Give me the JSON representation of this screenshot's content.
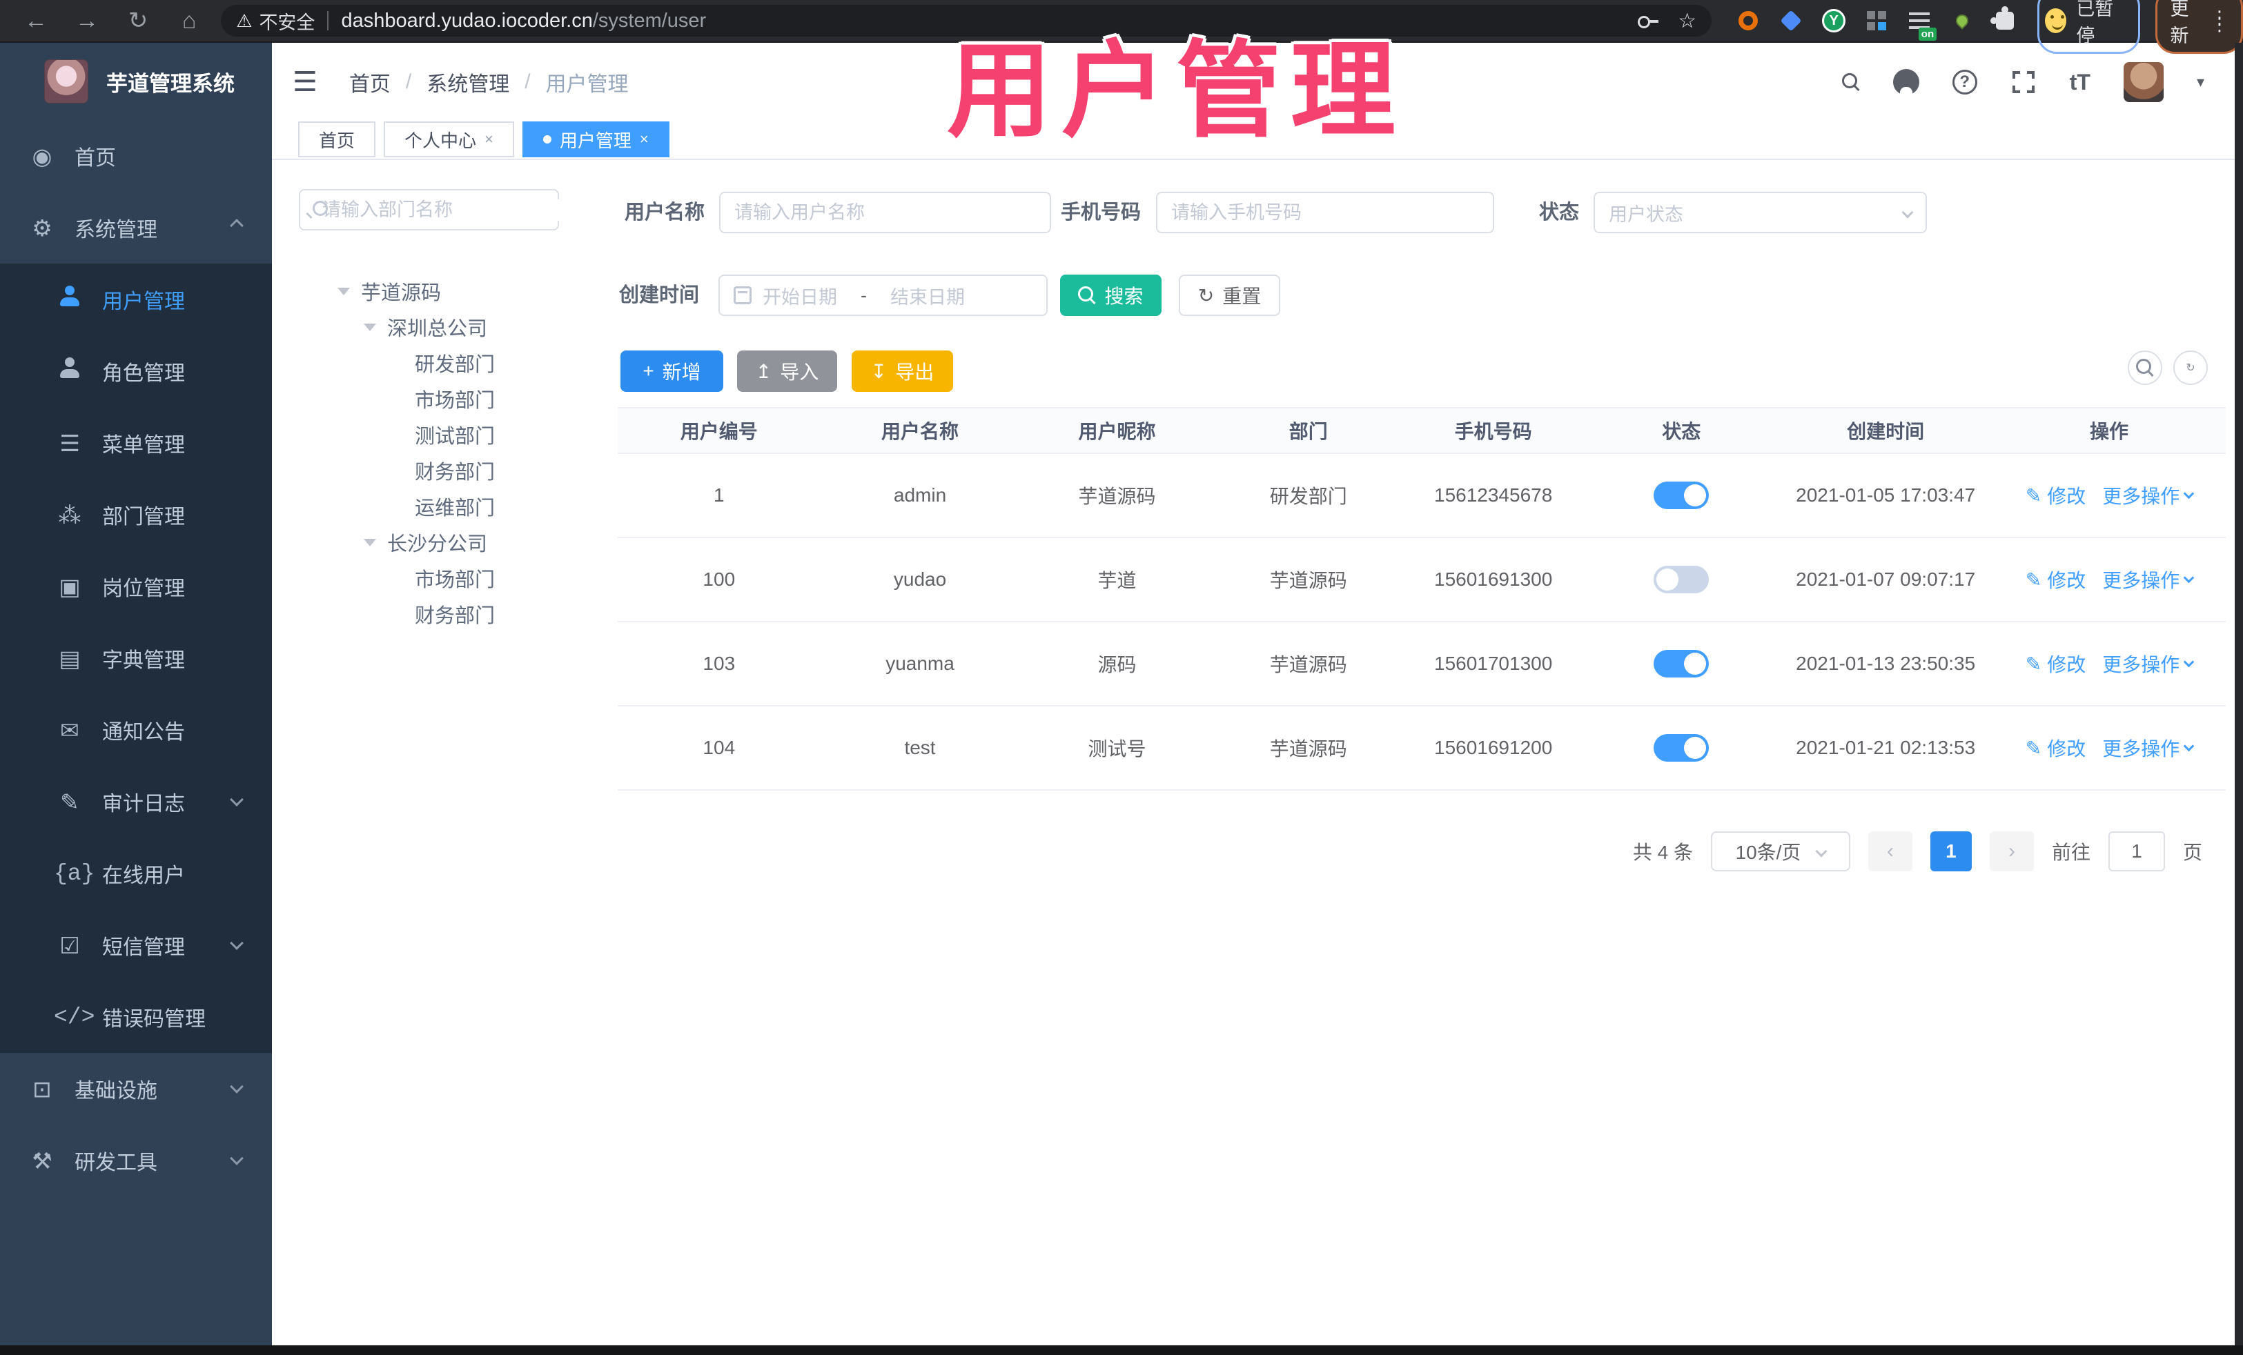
{
  "browser": {
    "security_label": "不安全",
    "url_host": "dashboard.yudao.iocoder.cn",
    "url_path": "/system/user",
    "profile_label": "已暂停",
    "update_label": "更新",
    "extension_y_label": "Y"
  },
  "watermark": "用户管理",
  "sidebar": {
    "title": "芋道管理系统",
    "items": [
      {
        "label": "首页"
      },
      {
        "label": "系统管理"
      },
      {
        "label": "用户管理"
      },
      {
        "label": "角色管理"
      },
      {
        "label": "菜单管理"
      },
      {
        "label": "部门管理"
      },
      {
        "label": "岗位管理"
      },
      {
        "label": "字典管理"
      },
      {
        "label": "通知公告"
      },
      {
        "label": "审计日志"
      },
      {
        "label": "在线用户"
      },
      {
        "label": "短信管理"
      },
      {
        "label": "错误码管理"
      },
      {
        "label": "基础设施"
      },
      {
        "label": "研发工具"
      }
    ],
    "online_icon_text": "{a}",
    "errcode_icon_text": "</>"
  },
  "header": {
    "breadcrumb": {
      "home": "首页",
      "system": "系统管理",
      "current": "用户管理"
    },
    "fontsize_icon_text": "tT",
    "help_icon_text": "?"
  },
  "tabs": {
    "home": "首页",
    "profile": "个人中心",
    "user": "用户管理",
    "close": "×"
  },
  "tree": {
    "search_placeholder": "请输入部门名称",
    "nodes": [
      {
        "label": "芋道源码",
        "level": 1,
        "expanded": true
      },
      {
        "label": "深圳总公司",
        "level": 2,
        "expanded": true
      },
      {
        "label": "研发部门",
        "level": 3
      },
      {
        "label": "市场部门",
        "level": 3
      },
      {
        "label": "测试部门",
        "level": 3
      },
      {
        "label": "财务部门",
        "level": 3
      },
      {
        "label": "运维部门",
        "level": 3
      },
      {
        "label": "长沙分公司",
        "level": 2,
        "expanded": true
      },
      {
        "label": "市场部门",
        "level": 3
      },
      {
        "label": "财务部门",
        "level": 3
      }
    ]
  },
  "filters": {
    "username_label": "用户名称",
    "username_placeholder": "请输入用户名称",
    "mobile_label": "手机号码",
    "mobile_placeholder": "请输入手机号码",
    "status_label": "状态",
    "status_placeholder": "用户状态",
    "date_label": "创建时间",
    "date_start_placeholder": "开始日期",
    "date_separator": "-",
    "date_end_placeholder": "结束日期",
    "search_label": "搜索",
    "reset_label": "重置"
  },
  "toolbar": {
    "add_label": "新增",
    "import_label": "导入",
    "export_label": "导出"
  },
  "table": {
    "columns": {
      "id": "用户编号",
      "username": "用户名称",
      "nickname": "用户昵称",
      "dept": "部门",
      "mobile": "手机号码",
      "status": "状态",
      "created": "创建时间",
      "actions": "操作"
    },
    "edit_label": "修改",
    "more_label": "更多操作",
    "rows": [
      {
        "id": "1",
        "username": "admin",
        "nickname": "芋道源码",
        "dept": "研发部门",
        "mobile": "15612345678",
        "status": true,
        "created": "2021-01-05 17:03:47"
      },
      {
        "id": "100",
        "username": "yudao",
        "nickname": "芋道",
        "dept": "芋道源码",
        "mobile": "15601691300",
        "status": false,
        "created": "2021-01-07 09:07:17"
      },
      {
        "id": "103",
        "username": "yuanma",
        "nickname": "源码",
        "dept": "芋道源码",
        "mobile": "15601701300",
        "status": true,
        "created": "2021-01-13 23:50:35"
      },
      {
        "id": "104",
        "username": "test",
        "nickname": "测试号",
        "dept": "芋道源码",
        "mobile": "15601691200",
        "status": true,
        "created": "2021-01-21 02:13:53"
      }
    ]
  },
  "pagination": {
    "total_label": "共 4 条",
    "page_size": "10条/页",
    "prev": "‹",
    "current": "1",
    "next": "›",
    "goto_label": "前往",
    "goto_value": "1",
    "page_suffix": "页"
  },
  "colors": {
    "accent_blue": "#409eff",
    "button_blue": "#2d8cf0",
    "teal": "#1abc9c",
    "amber": "#f7b500",
    "gray_button": "#909399",
    "sidebar_bg": "#304156",
    "submenu_bg": "#1f2d3d",
    "watermark_pink": "#f4416f"
  }
}
